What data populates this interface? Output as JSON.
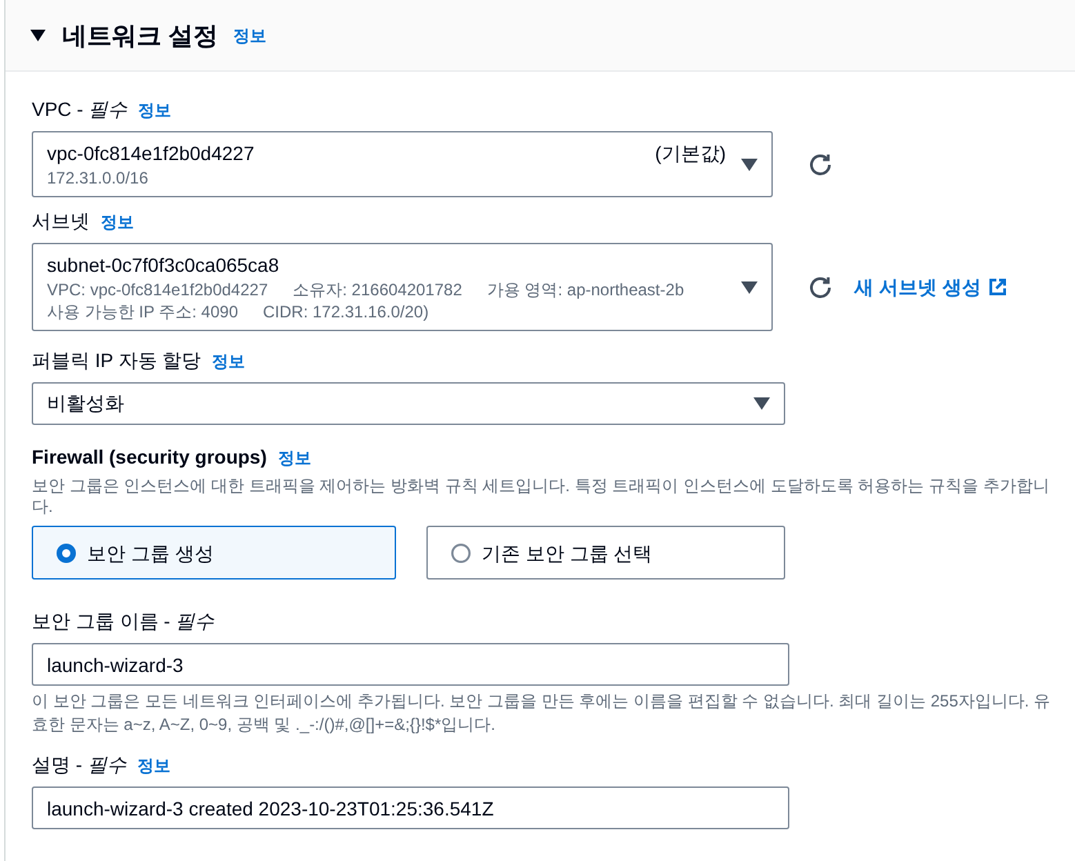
{
  "section": {
    "title": "네트워크 설정",
    "info": "정보",
    "expanded": true
  },
  "fields": [
    {
      "kind": "select",
      "label": "VPC - *필수*",
      "info": "정보",
      "value": "vpc-0fc814e1f2b0d4227",
      "tag": "(기본값)",
      "details": [
        [
          "172.31.0.0/16"
        ]
      ],
      "refresh": true
    },
    {
      "kind": "select",
      "label": "서브넷",
      "info": "정보",
      "value": "subnet-0c7f0f3c0ca065ca8",
      "details": [
        [
          "VPC: vpc-0fc814e1f2b0d4227",
          "소유자: 216604201782",
          "가용 영역: ap-northeast-2b"
        ],
        [
          "사용 가능한 IP 주소: 4090",
          "CIDR: 172.31.16.0/20)"
        ]
      ],
      "refresh": true,
      "link": "새 서브넷 생성"
    },
    {
      "kind": "select",
      "label": "퍼블릭 IP 자동 할당",
      "info": "정보",
      "value": "비활성화"
    },
    {
      "kind": "tiles",
      "title": "Firewall (security groups)",
      "info": "정보",
      "description": "보안 그룹은 인스턴스에 대한 트래픽을 제어하는 방화벽 규칙 세트입니다. 특정 트래픽이 인스턴스에 도달하도록 허용하는 규칙을 추가합니다.",
      "options": [
        {
          "label": "보안 그룹 생성",
          "selected": true
        },
        {
          "label": "기존 보안 그룹 선택",
          "selected": false
        }
      ]
    },
    {
      "kind": "input",
      "label": "보안 그룹 이름 - *필수*",
      "value": "launch-wizard-3",
      "help": "이 보안 그룹은 모든 네트워크 인터페이스에 추가됩니다. 보안 그룹을 만든 후에는 이름을 편집할 수 없습니다. 최대 길이는 255자입니다. 유효한 문자는 a~z, A~Z, 0~9, 공백 및 ._-:/()#,@[]+=&;{}!$*입니다."
    },
    {
      "kind": "input",
      "label": "설명 - *필수*",
      "info": "정보",
      "value": "launch-wizard-3 created 2023-10-23T01:25:36.541Z"
    }
  ]
}
